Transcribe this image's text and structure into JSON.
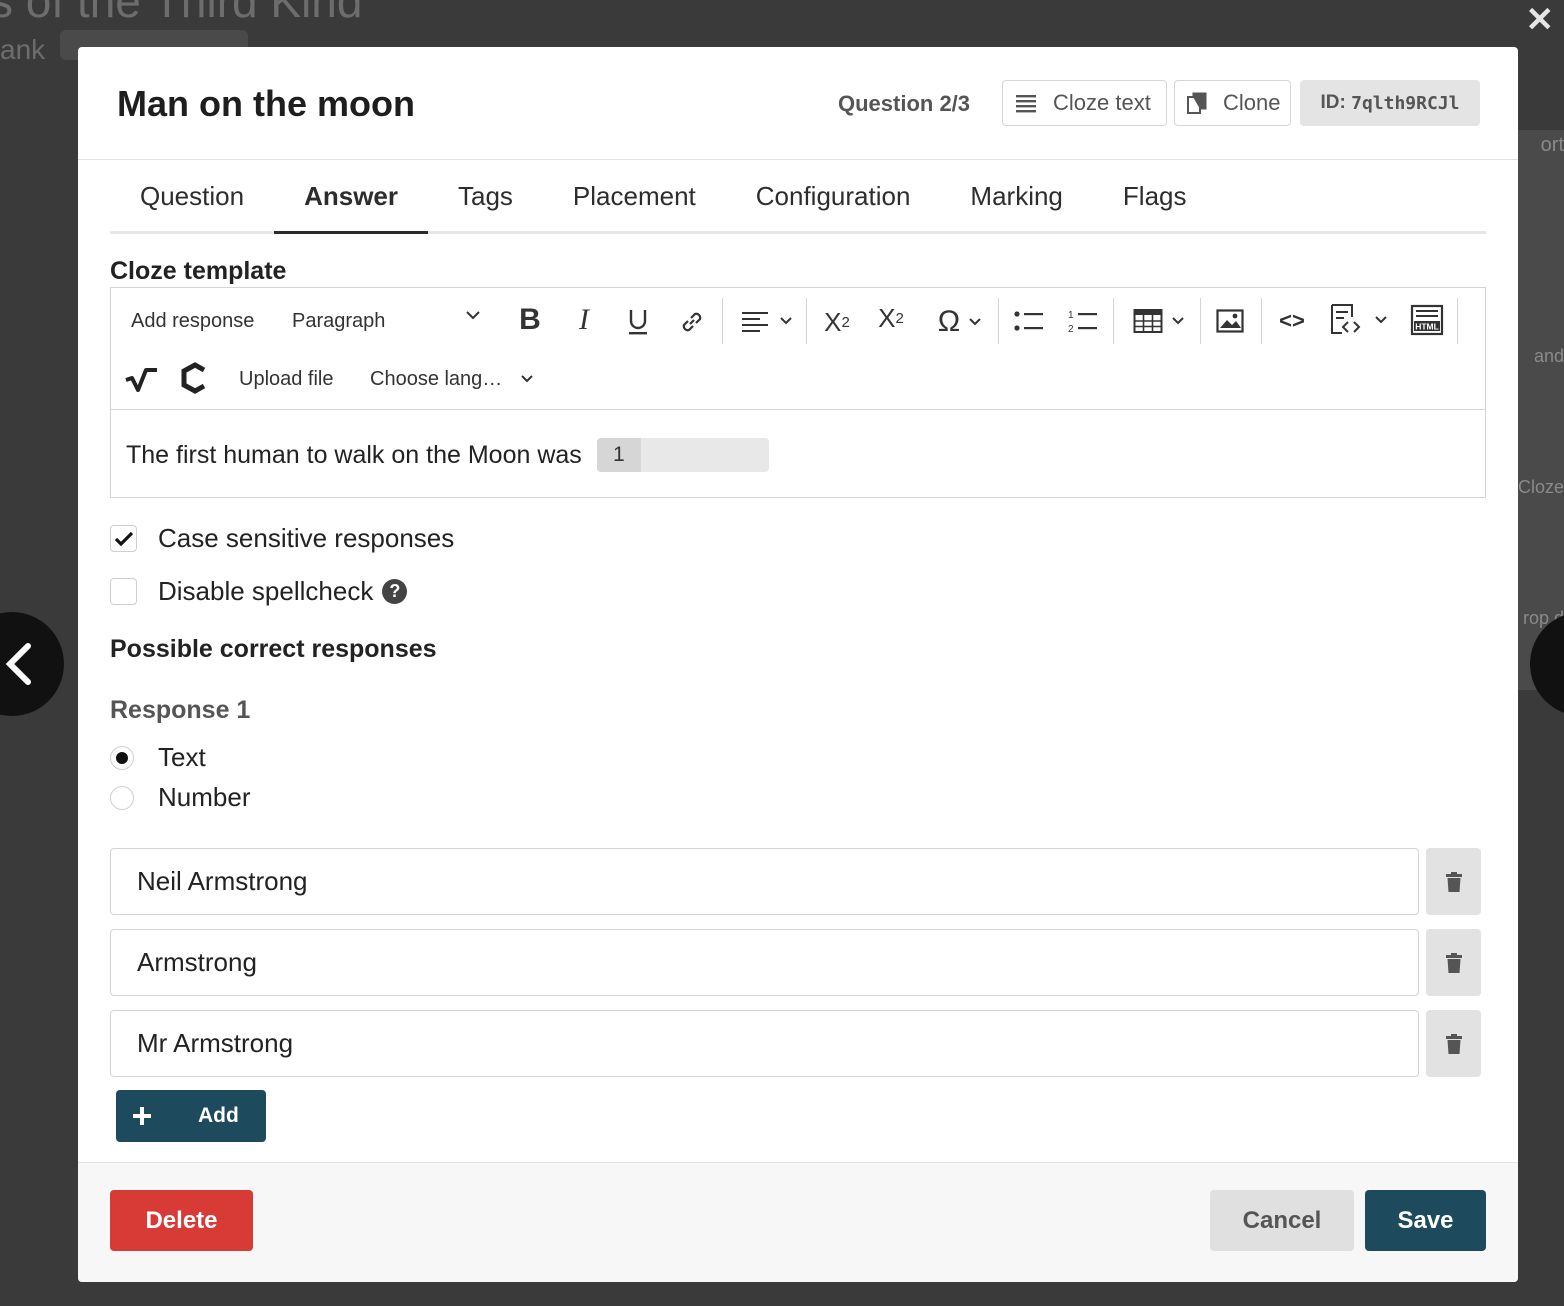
{
  "background": {
    "title": "s of the Third Kind",
    "subtitle": "ank",
    "right_texts": [
      "ort",
      "and",
      "Cloze",
      "rop d"
    ]
  },
  "modal": {
    "title": "Man on the moon",
    "question_count": "Question 2/3",
    "type_button": "Cloze text",
    "clone_button": "Clone",
    "id_label": "ID:",
    "id_value": "7qlth9RCJl"
  },
  "tabs": [
    {
      "label": "Question",
      "active": false
    },
    {
      "label": "Answer",
      "active": true
    },
    {
      "label": "Tags",
      "active": false
    },
    {
      "label": "Placement",
      "active": false
    },
    {
      "label": "Configuration",
      "active": false
    },
    {
      "label": "Marking",
      "active": false
    },
    {
      "label": "Flags",
      "active": false
    }
  ],
  "cloze_template": {
    "label": "Cloze template",
    "toolbar": {
      "add_response": "Add response",
      "paragraph": "Paragraph",
      "upload_file": "Upload file",
      "choose_language": "Choose lang…"
    },
    "content_text": "The first human to walk on the Moon was",
    "field_number": "1"
  },
  "options": {
    "case_sensitive": {
      "label": "Case sensitive responses",
      "checked": true
    },
    "disable_spellcheck": {
      "label": "Disable spellcheck",
      "checked": false
    }
  },
  "responses": {
    "heading": "Possible correct responses",
    "response_label": "Response 1",
    "type_options": [
      {
        "label": "Text",
        "selected": true
      },
      {
        "label": "Number",
        "selected": false
      }
    ],
    "answers": [
      "Neil Armstrong",
      "Armstrong",
      "Mr Armstrong"
    ],
    "add_label": "Add"
  },
  "footer": {
    "delete": "Delete",
    "cancel": "Cancel",
    "save": "Save"
  },
  "colors": {
    "primary": "#1e4a5e",
    "danger": "#d83a35",
    "secondary": "#e0e0e0"
  }
}
